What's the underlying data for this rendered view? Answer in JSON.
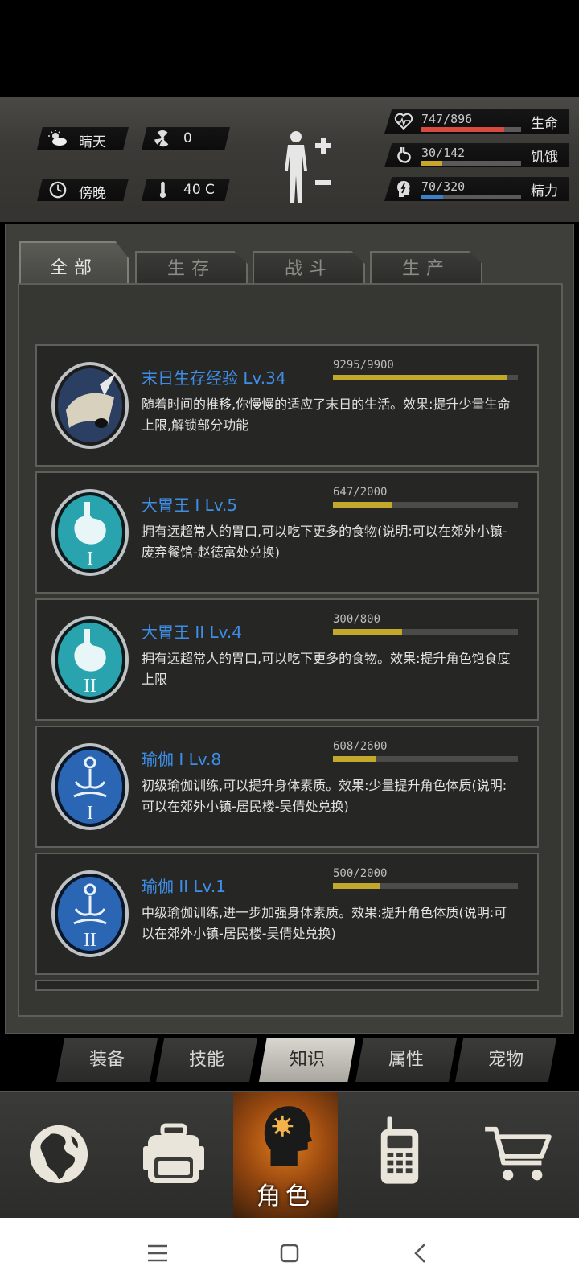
{
  "status": {
    "weather": "晴天",
    "radiation": "0",
    "time_of_day": "傍晚",
    "temperature": "40 C",
    "stats": [
      {
        "key": "health",
        "value": "747/896",
        "label": "生命",
        "current": 747,
        "max": 896,
        "color": "#d64a3f"
      },
      {
        "key": "hunger",
        "value": "30/142",
        "label": "饥饿",
        "current": 30,
        "max": 142,
        "color": "#c9a52c"
      },
      {
        "key": "energy",
        "value": "70/320",
        "label": "精力",
        "current": 70,
        "max": 320,
        "color": "#3a80cc"
      }
    ]
  },
  "tabs": [
    "全部",
    "生存",
    "战斗",
    "生产"
  ],
  "active_tab": 0,
  "skills": [
    {
      "title": "末日生存经验 Lv.34",
      "progress": "9295/9900",
      "current": 9295,
      "max": 9900,
      "icon": "scroll-quill-icon",
      "desc": "随着时间的推移,你慢慢的适应了末日的生活。效果:提升少量生命上限,解锁部分功能"
    },
    {
      "title": "大胃王 I Lv.5",
      "progress": "647/2000",
      "current": 647,
      "max": 2000,
      "icon": "stomach-1-icon",
      "desc": "拥有远超常人的胃口,可以吃下更多的食物(说明:可以在郊外小镇-废弃餐馆-赵德富处兑换)"
    },
    {
      "title": "大胃王 II Lv.4",
      "progress": "300/800",
      "current": 300,
      "max": 800,
      "icon": "stomach-2-icon",
      "desc": "拥有远超常人的胃口,可以吃下更多的食物。效果:提升角色饱食度上限"
    },
    {
      "title": "瑜伽 I Lv.8",
      "progress": "608/2600",
      "current": 608,
      "max": 2600,
      "icon": "yoga-1-icon",
      "desc": "初级瑜伽训练,可以提升身体素质。效果:少量提升角色体质(说明:可以在郊外小镇-居民楼-吴倩处兑换)"
    },
    {
      "title": "瑜伽 II Lv.1",
      "progress": "500/2000",
      "current": 500,
      "max": 2000,
      "icon": "yoga-2-icon",
      "desc": "中级瑜伽训练,进一步加强身体素质。效果:提升角色体质(说明:可以在郊外小镇-居民楼-吴倩处兑换)"
    }
  ],
  "subnav": [
    "装备",
    "技能",
    "知识",
    "属性",
    "宠物"
  ],
  "active_subnav": 2,
  "bottom_nav": {
    "items": [
      "globe-icon",
      "backpack-icon",
      "character-head-icon",
      "walkie-talkie-icon",
      "shopping-cart-icon"
    ],
    "active_label": "角色"
  },
  "system_nav": [
    "menu-icon",
    "home-icon",
    "back-icon"
  ]
}
